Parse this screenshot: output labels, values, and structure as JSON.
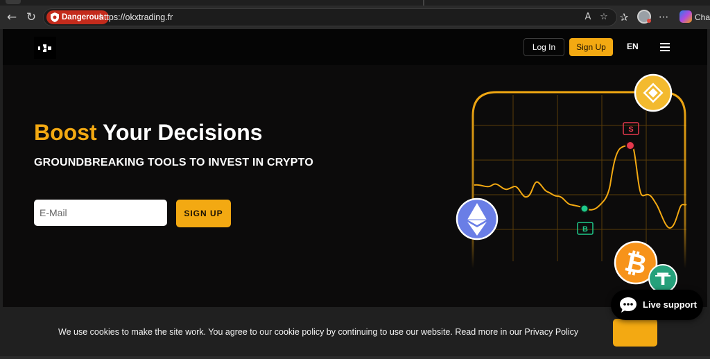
{
  "browser": {
    "security_badge": "Dangerous",
    "url": "https://okxtrading.fr",
    "chat_label": "Chat"
  },
  "header": {
    "login_label": "Log In",
    "signup_label": "Sign Up",
    "language": "EN"
  },
  "hero": {
    "title_accent": "Boost",
    "title_rest": " Your Decisions",
    "subtitle": "GROUNDBREAKING TOOLS TO INVEST IN CRYPTO",
    "email_placeholder": "E-Mail",
    "signup_label": "SIGN UP"
  },
  "chart_illustration": {
    "sell_marker": "S",
    "buy_marker": "B",
    "coins": [
      "bnb-icon",
      "ethereum-icon",
      "bitcoin-icon",
      "tether-icon"
    ],
    "accent": "#f3a912"
  },
  "cookie_banner": {
    "text": "We use cookies to make the site work. You agree to our cookie policy by continuing to use our website. Read more in our Privacy Policy"
  },
  "live_support": {
    "label": "Live support"
  },
  "colors": {
    "accent": "#f3a912",
    "danger": "#c42b1c",
    "background": "#0c0b0b"
  }
}
